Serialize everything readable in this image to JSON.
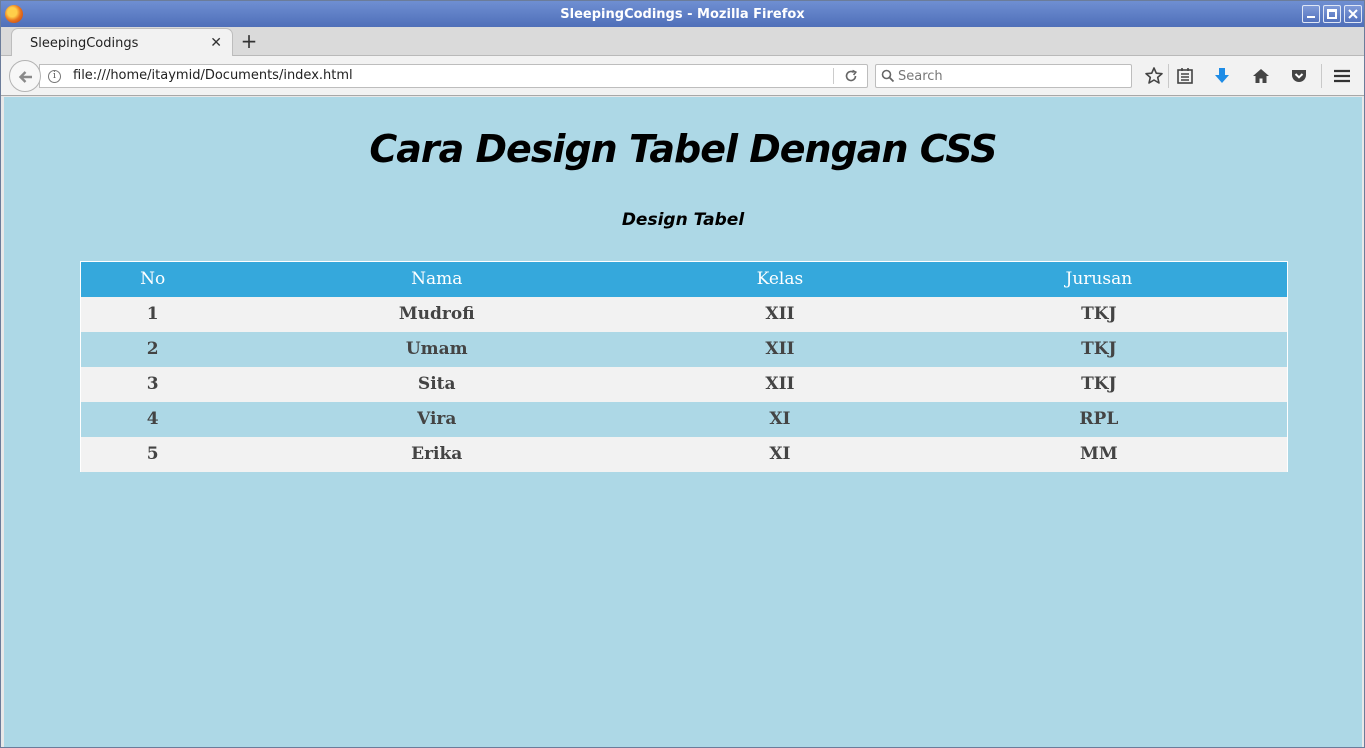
{
  "window": {
    "title": "SleepingCodings - Mozilla Firefox"
  },
  "tabs": [
    {
      "label": "SleepingCodings",
      "active": true
    }
  ],
  "navbar": {
    "url": "file:///home/itaymid/Documents/index.html",
    "search_placeholder": "Search"
  },
  "page": {
    "title": "Cara Design Tabel Dengan CSS",
    "subtitle": "Design Tabel",
    "table": {
      "headers": [
        "No",
        "Nama",
        "Kelas",
        "Jurusan"
      ],
      "rows": [
        [
          "1",
          "Mudrofi",
          "XII",
          "TKJ"
        ],
        [
          "2",
          "Umam",
          "XII",
          "TKJ"
        ],
        [
          "3",
          "Sita",
          "XII",
          "TKJ"
        ],
        [
          "4",
          "Vira",
          "XI",
          "RPL"
        ],
        [
          "5",
          "Erika",
          "XI",
          "MM"
        ]
      ]
    }
  },
  "colors": {
    "page_background": "#add8e6",
    "header_background": "#35a8dc",
    "odd_row_background": "#f2f2f2",
    "download_icon": "#1e8ce6"
  },
  "icons": [
    "firefox-icon",
    "minimize-icon",
    "maximize-icon",
    "close-icon",
    "tab-close-icon",
    "new-tab-icon",
    "back-icon",
    "info-icon",
    "reload-icon",
    "search-icon",
    "bookmark-star-icon",
    "reading-list-icon",
    "download-icon",
    "home-icon",
    "pocket-icon",
    "menu-icon"
  ]
}
